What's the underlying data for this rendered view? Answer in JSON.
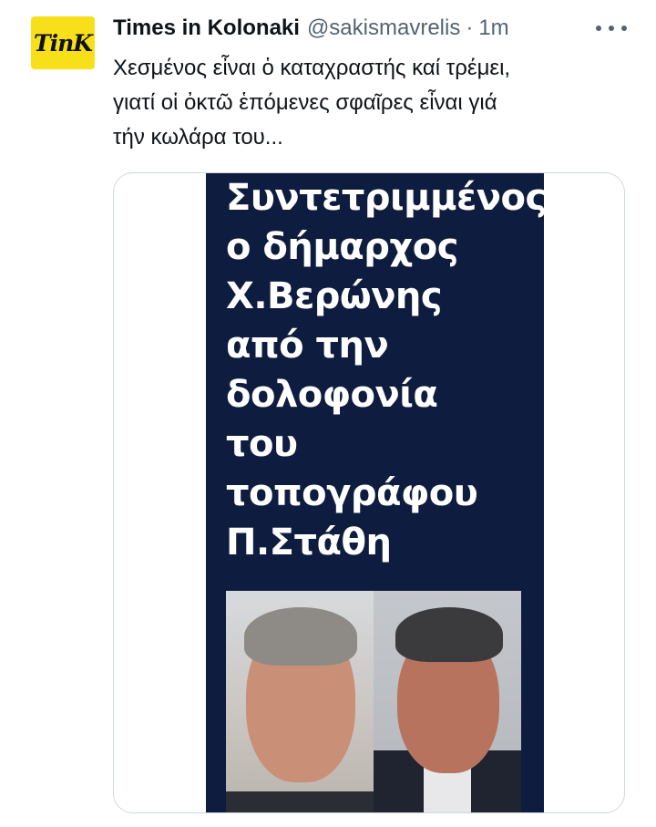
{
  "tweet": {
    "display_name": "Times in Kolonaki",
    "handle": "@sakismavrelis",
    "separator": "·",
    "time": "1m",
    "avatar_text": "TinK",
    "text_lines": [
      "Χεσμένος εἶναι ὁ καταχραστής καί τρέμει,",
      "γιατί οἱ ὀκτῶ ἑπόμενες σφαῖρες εἶναι γιά",
      "τήν κωλάρα του..."
    ]
  },
  "media": {
    "headline_lines": [
      "Συντετριμμένος",
      "ο δήμαρχος",
      "Χ.Βερώνης",
      "από την",
      "δολοφονία",
      "του",
      "τοπογράφου",
      "Π.Στάθη"
    ]
  },
  "colors": {
    "poster_bg": "#0e1d3f",
    "avatar_bg": "#f7e01a",
    "secondary_text": "#536471",
    "border": "#cfd9de"
  },
  "icons": {
    "more": "more-horizontal-icon"
  }
}
